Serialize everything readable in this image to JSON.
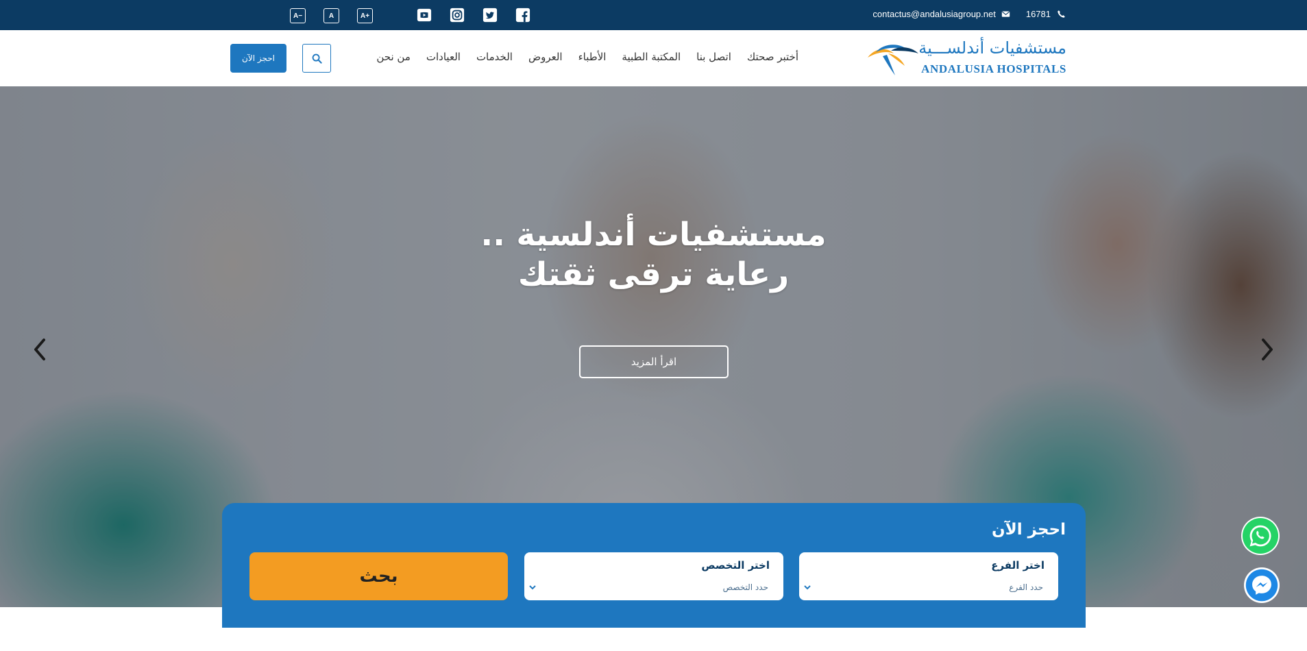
{
  "topbar": {
    "font_controls": [
      "A−",
      "A",
      "A+"
    ],
    "social_icons": [
      "youtube-icon",
      "instagram-icon",
      "twitter-icon",
      "facebook-icon"
    ],
    "email": "contactus@andalusiagroup.net",
    "phone": "16781"
  },
  "header": {
    "logo_ar": "مستشفيات أندلســـية",
    "logo_en": "ANDALUSIA HOSPITALS",
    "nav": [
      "من نحن",
      "العيادات",
      "الخدمات",
      "العروض",
      "الأطباء",
      "المكتبة الطبية",
      "اتصل بنا",
      "أختبر صحتك"
    ],
    "book_label": "احجز الآن"
  },
  "hero": {
    "title_line1": "مستشفيات أندلسية ..",
    "title_line2": "رعاية ترقى ثقتك",
    "read_more": "اقرأ المزيد"
  },
  "booking": {
    "title": "احجز الآن",
    "branch_label": "اختر الفرع",
    "branch_placeholder": "حدد الفرع",
    "specialty_label": "اختر التخصص",
    "specialty_placeholder": "حدد التخصص",
    "search_label": "بحث"
  },
  "colors": {
    "topbar": "#0c3b63",
    "primary": "#1e77bf",
    "accent": "#f39c22"
  }
}
